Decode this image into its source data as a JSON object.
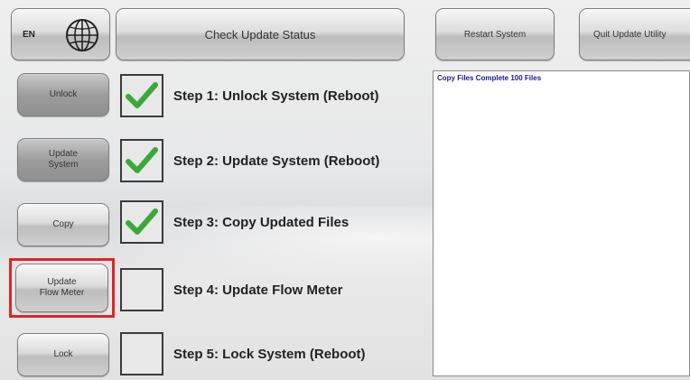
{
  "language": {
    "code": "EN",
    "icon": "globe-icon"
  },
  "toolbar": {
    "check_status": "Check Update Status",
    "restart": "Restart System",
    "quit": "Quit Update Utility"
  },
  "steps": [
    {
      "button": "Unlock",
      "checked": true,
      "label": "Step 1: Unlock System (Reboot)"
    },
    {
      "button": "Update\nSystem",
      "checked": true,
      "label": "Step 2: Update System (Reboot)"
    },
    {
      "button": "Copy",
      "checked": true,
      "label": "Step 3: Copy Updated Files"
    },
    {
      "button": "Update\nFlow Meter",
      "checked": false,
      "label": "Step 4: Update Flow Meter"
    },
    {
      "button": "Lock",
      "checked": false,
      "label": "Step 5: Lock System (Reboot)"
    }
  ],
  "log": {
    "text": "Copy Files Complete 100 Files"
  },
  "colors": {
    "check": "#3aa83a",
    "highlight": "#e12424",
    "log_text": "#1a1a8a"
  }
}
